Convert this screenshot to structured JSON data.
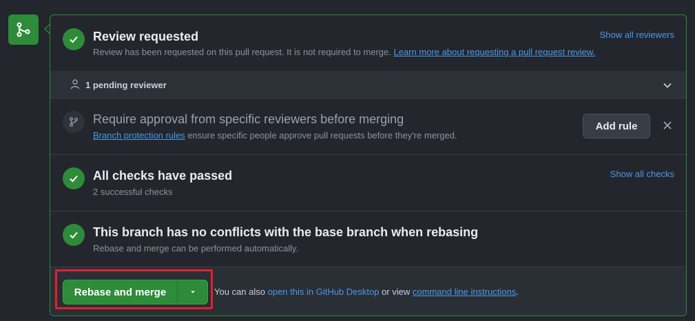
{
  "page_top_text": "",
  "review": {
    "title": "Review requested",
    "description": "Review has been requested on this pull request. It is not required to merge.",
    "learn_more_link": "Learn more about requesting a pull request review.",
    "show_all_link": "Show all reviewers"
  },
  "pending": {
    "label": "1 pending reviewer"
  },
  "approval_rule": {
    "title": "Require approval from specific reviewers before merging",
    "branch_protection_link": "Branch protection rules",
    "description_rest": "ensure specific people approve pull requests before they're merged.",
    "add_rule_button": "Add rule"
  },
  "checks": {
    "title": "All checks have passed",
    "subtitle": "2 successful checks",
    "show_all_link": "Show all checks"
  },
  "conflicts": {
    "title": "This branch has no conflicts with the base branch when rebasing",
    "subtitle": "Rebase and merge can be performed automatically."
  },
  "merge": {
    "button_label": "Rebase and merge",
    "footer_prefix": "You can also",
    "desktop_link": "open this in GitHub Desktop",
    "footer_middle": "or view",
    "cli_link": "command line instructions",
    "footer_suffix": "."
  },
  "colors": {
    "success_green": "#2e8b3a",
    "link_blue": "#4a9ae8",
    "highlight_red": "#e5202a",
    "background": "#23262c"
  }
}
